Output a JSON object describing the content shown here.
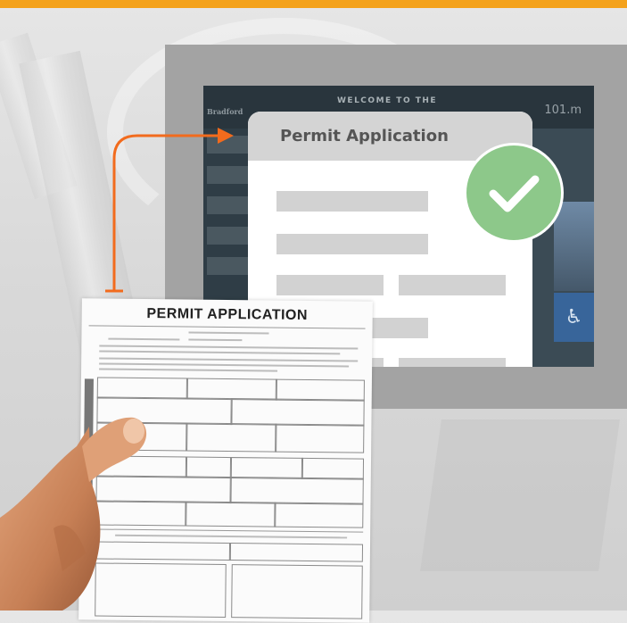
{
  "accent_colors": {
    "top_bar": "#f4a21c",
    "connector": "#f26b1d",
    "check_badge": "#8dc88a"
  },
  "screen": {
    "welcome_text": "WELCOME TO THE",
    "left_text": "Bradford",
    "right_text": "101.m"
  },
  "dialog": {
    "title": "Permit Application",
    "status_icon": "checkmark-icon"
  },
  "paper_form": {
    "title": "PERMIT APPLICATION"
  },
  "icons": [
    "checkmark-icon",
    "accessibility-icon",
    "arrow-right-icon"
  ]
}
